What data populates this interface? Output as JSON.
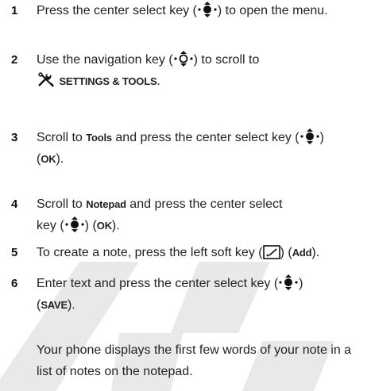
{
  "watermark": {
    "color": "#e9e9e9"
  },
  "steps": [
    {
      "num": "1",
      "parts": [
        "Press the center select key (",
        ") to open the menu."
      ]
    },
    {
      "num": "2",
      "parts": [
        "Use the navigation key (",
        ") to scroll to"
      ],
      "menu": "SETTINGS & TOOLS",
      "menu_end": "."
    },
    {
      "num": "3",
      "parts": [
        "Scroll to ",
        " and press the center select key (",
        ")"
      ],
      "bold1": "Tools",
      "ok_open": "(",
      "ok": "OK",
      "ok_close": ")."
    },
    {
      "num": "4",
      "parts": [
        "Scroll to ",
        " and press the center select"
      ],
      "bold1": "Notepad",
      "line2": "key (",
      "mid": ") (",
      "ok": "OK",
      "end": ")."
    },
    {
      "num": "5",
      "parts": [
        "To create a note, press the left soft key (",
        ") (",
        ")."
      ],
      "bold1": "Add"
    },
    {
      "num": "6",
      "parts": [
        "Enter text and press the center select key (",
        ")"
      ],
      "save_open": "(",
      "save": "SAVE",
      "save_close": ")."
    }
  ],
  "note": "Your phone displays the first few words of your note in a list of notes on the notepad.",
  "icons": {
    "select": "center-select-key-icon",
    "nav": "navigation-key-icon",
    "settings": "settings-tools-icon",
    "softkey": "left-soft-key-icon"
  }
}
